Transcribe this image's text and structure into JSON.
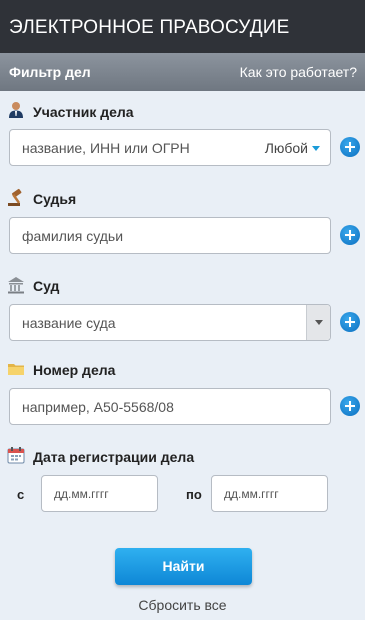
{
  "header": {
    "title": "ЭЛЕКТРОННОЕ ПРАВОСУДИЕ"
  },
  "filter_bar": {
    "title": "Фильтр дел",
    "help_link": "Как это работает?"
  },
  "participant": {
    "label": "Участник дела",
    "icon": "person-icon",
    "placeholder": "название, ИНН или ОГРН",
    "role_select": "Любой"
  },
  "judge": {
    "label": "Судья",
    "icon": "gavel-icon",
    "placeholder": "фамилия судьи"
  },
  "court": {
    "label": "Суд",
    "icon": "courthouse-icon",
    "placeholder": "название суда"
  },
  "case_number": {
    "label": "Номер дела",
    "icon": "folder-icon",
    "placeholder": "например, А50-5568/08"
  },
  "registration_date": {
    "label": "Дата регистрации дела",
    "icon": "calendar-icon",
    "from_label": "с",
    "from_placeholder": "дд.мм.гггг",
    "to_label": "по",
    "to_placeholder": "дд.мм.гггг"
  },
  "actions": {
    "search_button": "Найти",
    "reset_link": "Сбросить все"
  },
  "colors": {
    "header_bg": "#2f3238",
    "accent_blue": "#1a9bd8",
    "panel_bg": "#e9eff6"
  }
}
